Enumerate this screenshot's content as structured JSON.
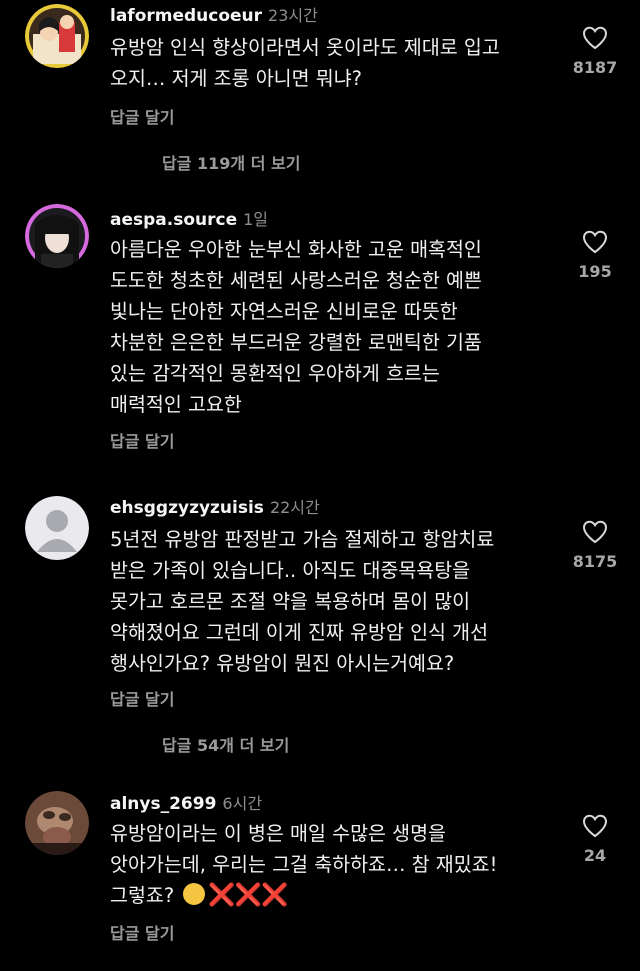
{
  "comments": [
    {
      "username": "laformeducoeur",
      "time": "23시간",
      "lines": [
        "유방암 인식 향상이라면서 옷이라도 제대로 입고",
        "오지… 저게 조롱 아니면 뭐냐?"
      ],
      "likes": "8187",
      "reply_label": "답글 달기",
      "view_replies": "답글 119개 더 보기"
    },
    {
      "username": "aespa.source",
      "time": "1일",
      "lines": [
        "아름다운 우아한 눈부신 화사한 고운 매혹적인",
        "도도한 청초한 세련된 사랑스러운 청순한 예쁜",
        "빛나는 단아한 자연스러운 신비로운 따뜻한",
        "차분한 은은한 부드러운 강렬한 로맨틱한 기품",
        "있는 감각적인 몽환적인 우아하게 흐르는",
        "매력적인 고요한"
      ],
      "likes": "195",
      "reply_label": "답글 달기"
    },
    {
      "username": "ehsggzyzyzuisis",
      "time": "22시간",
      "lines": [
        "5년전 유방암 판정받고 가슴 절제하고 항암치료",
        "받은 가족이 있습니다.. 아직도 대중목욕탕을",
        "못가고 호르몬 조절 약을 복용하며 몸이 많이",
        "약해졌어요 그런데 이게 진짜 유방암 인식 개선",
        "행사인가요? 유방암이 뭔진 아시는거예요?"
      ],
      "likes": "8175",
      "reply_label": "답글 달기",
      "view_replies": "답글 54개 더 보기"
    },
    {
      "username": "alnys_2699",
      "time": "6시간",
      "lines": [
        "유방암이라는 이 병은 매일 수많은 생명을",
        "앗아가는데, 우리는 그걸 축하하죠… 참 재밌죠!",
        "그렇죠?"
      ],
      "last_line_emoji": "hugging-face-icon",
      "last_line_marks": "❌❌❌",
      "likes": "24",
      "reply_label": "답글 달기"
    }
  ],
  "colors": {
    "background": "#000000",
    "text": "#f0f0f0",
    "muted": "#9a9a9a",
    "x_mark": "#e0245e"
  }
}
